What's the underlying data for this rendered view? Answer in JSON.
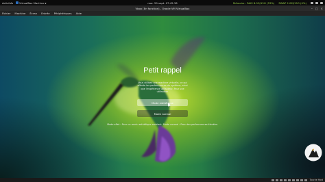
{
  "topbar": {
    "activities": "Activités",
    "app_name": "VirtualBox Machine",
    "app_chevron": "▾",
    "clock": "mar. 29 sept.  07:42:36",
    "mem_monitor": "Mémoire : RAM 8.0G/15G (53%)",
    "swap_monitor": "SWAP 2.0M/15G (0%)",
    "accent_color": "#9ad14b"
  },
  "window": {
    "title": "Vbox (En fonction) - Oracle VM VirtualBox",
    "controls": [
      "–",
      "□",
      "×"
    ]
  },
  "menubar": {
    "items": [
      "Fichier",
      "Machine",
      "Écran",
      "Entrée",
      "Périphériques",
      "Aide"
    ]
  },
  "dialog": {
    "title": "Petit rappel",
    "description": "Vous utilisez une machine virtuelle, ce qui affecte les performances du système, ainsi que l'expérience utilisateur. Pour une utilisation",
    "aesthetic_button": "Mode esthétique",
    "normal_button": "Mode normal",
    "note": "Mode effet : Pour un rendu esthétique ambiant. Mode normal : Pour des performances élevées."
  },
  "statusbar": {
    "icons": [
      "hdd-icon",
      "optical-icon",
      "audio-icon",
      "network-icon",
      "usb-icon",
      "shared-folder-icon",
      "display-icon",
      "recording-icon",
      "mouse-integration-icon"
    ],
    "host_key": "Touche Host"
  }
}
